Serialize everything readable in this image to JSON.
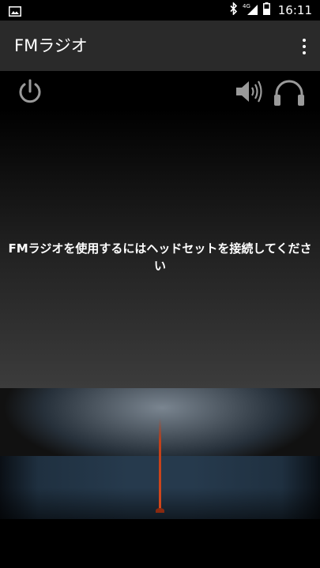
{
  "status_bar": {
    "time": "16:11",
    "network": "4G",
    "icons": [
      "image-icon",
      "bluetooth-icon",
      "signal-icon",
      "battery-icon"
    ]
  },
  "app_bar": {
    "title": "FMラジオ",
    "menu_icon": "more-vert-icon"
  },
  "controls": {
    "power_icon": "power-icon",
    "speaker_icon": "speaker-icon",
    "headset_icon": "headset-icon"
  },
  "message": "FMラジオを使用するにはヘッドセットを接続してください",
  "colors": {
    "app_bar_bg": "#2a2a2a",
    "needle": "#d4481c",
    "tuner_band": "#263a4d",
    "icon_gray": "#9a9a9a"
  }
}
